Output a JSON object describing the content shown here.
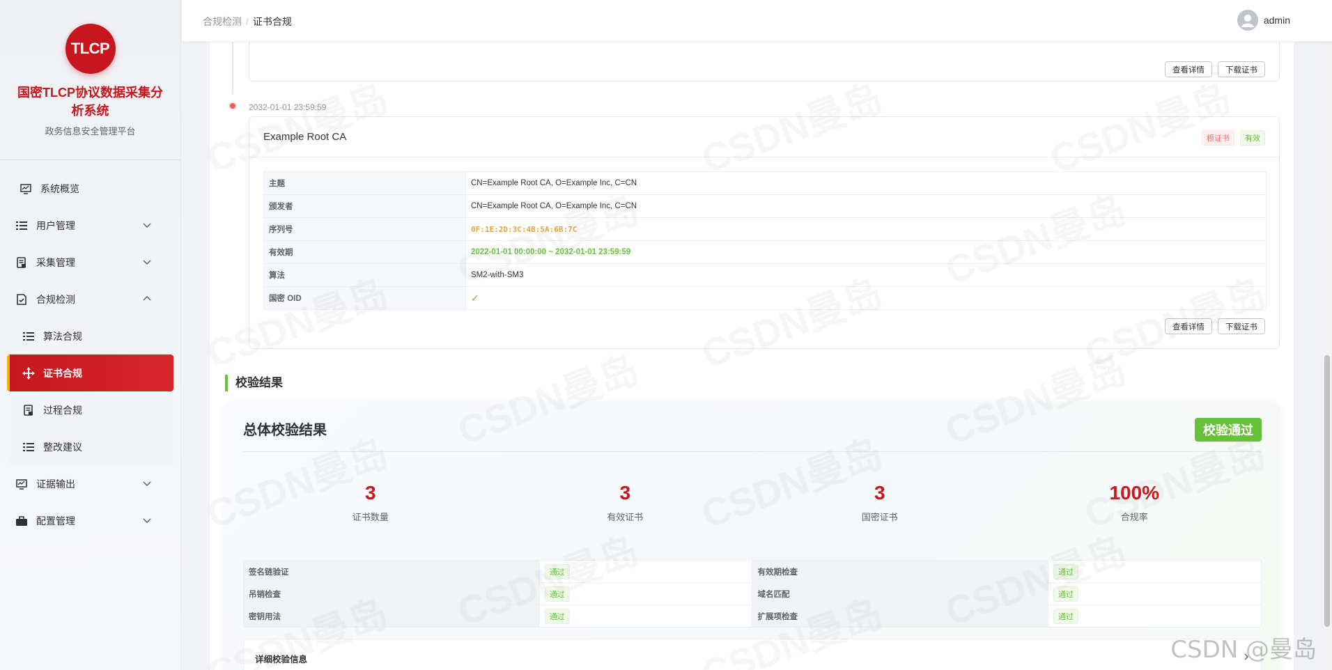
{
  "brand": {
    "logo_text": "TLCP",
    "title": "国密TLCP协议数据采集分析系统",
    "subtitle": "政务信息安全管理平台"
  },
  "menu": {
    "items": [
      {
        "label": "系统概览",
        "icon": "monitor-icon"
      },
      {
        "label": "用户管理",
        "icon": "list-icon"
      },
      {
        "label": "采集管理",
        "icon": "document-icon"
      },
      {
        "label": "合规检测",
        "icon": "document-check-icon"
      }
    ],
    "submenu": [
      {
        "label": "算法合规",
        "icon": "list-icon"
      },
      {
        "label": "证书合规",
        "icon": "move-icon",
        "active": true
      },
      {
        "label": "过程合规",
        "icon": "document-icon"
      },
      {
        "label": "整改建议",
        "icon": "list-icon"
      }
    ],
    "bottom_items": [
      {
        "label": "证据输出",
        "icon": "monitor-icon"
      },
      {
        "label": "配置管理",
        "icon": "briefcase-icon"
      }
    ]
  },
  "header": {
    "breadcrumb_parent": "合规检测",
    "breadcrumb_sep": "/",
    "breadcrumb_current": "证书合规",
    "username": "admin"
  },
  "prev_card": {
    "view_detail": "查看详情",
    "download": "下载证书"
  },
  "timeline_time": "2032-01-01 23:59:59",
  "cert": {
    "name": "Example Root CA",
    "tag_root": "根证书",
    "tag_valid": "有效",
    "rows": [
      {
        "key": "主题",
        "value": "CN=Example Root CA, O=Example Inc, C=CN"
      },
      {
        "key": "颁发者",
        "value": "CN=Example Root CA, O=Example Inc, C=CN"
      },
      {
        "key": "序列号",
        "value": "0F:1E:2D:3C:4B:5A:6B:7C"
      },
      {
        "key": "有效期",
        "value": "2022-01-01 00:00:00 ~ 2032-01-01 23:59:59"
      },
      {
        "key": "算法",
        "value": "SM2-with-SM3"
      },
      {
        "key": "国密 OID",
        "value": "✓"
      }
    ],
    "view_detail": "查看详情",
    "download": "下载证书"
  },
  "result": {
    "section_title": "校验结果",
    "title": "总体校验结果",
    "badge": "校验通过",
    "stats": [
      {
        "value": "3",
        "label": "证书数量"
      },
      {
        "value": "3",
        "label": "有效证书"
      },
      {
        "value": "3",
        "label": "国密证书"
      },
      {
        "value": "100%",
        "label": "合规率"
      }
    ],
    "checks": [
      {
        "left_key": "签名链验证",
        "left_val": "通过",
        "right_key": "有效期检查",
        "right_val": "通过"
      },
      {
        "left_key": "吊销检查",
        "left_val": "通过",
        "right_key": "域名匹配",
        "right_val": "通过"
      },
      {
        "left_key": "密钥用法",
        "left_val": "通过",
        "right_key": "扩展项检查",
        "right_val": "通过"
      }
    ],
    "detail_label": "详细校验信息"
  },
  "watermark_text": "CSDN曼岛",
  "csdn_mark": "CSDN @曼岛",
  "colors": {
    "brand_red": "#c8161d",
    "success_green": "#67c23a",
    "warning_orange": "#e6a23c"
  }
}
